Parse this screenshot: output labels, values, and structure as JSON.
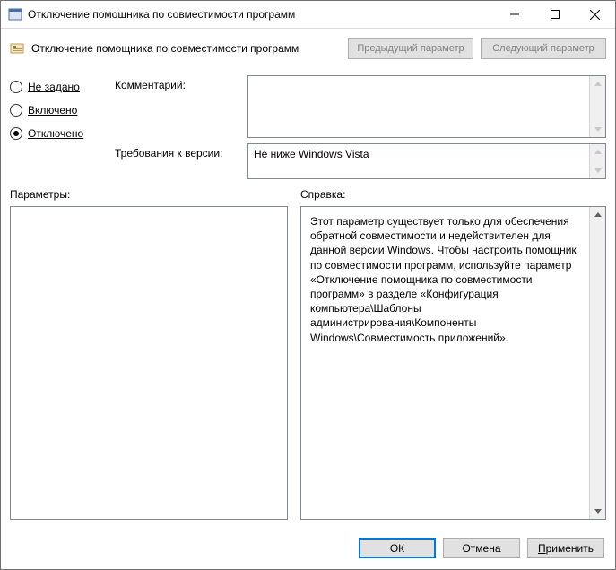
{
  "titlebar": {
    "title": "Отключение помощника по совместимости программ"
  },
  "toolbar": {
    "title": "Отключение помощника по совместимости программ",
    "prev_label": "Предыдущий параметр",
    "next_label": "Следующий параметр"
  },
  "radios": {
    "not_configured": "Не задано",
    "enabled": "Включено",
    "disabled": "Отключено"
  },
  "form": {
    "comment_label": "Комментарий:",
    "comment_value": "",
    "requirements_label": "Требования к версии:",
    "requirements_value": "Не ниже Windows Vista"
  },
  "lower": {
    "params_label": "Параметры:",
    "help_label": "Справка:",
    "help_text": "Этот параметр существует только для обеспечения обратной совместимости и недействителен для данной версии Windows. Чтобы настроить помощник по совместимости программ, используйте параметр «Отключение помощника по совместимости программ» в разделе «Конфигурация компьютера\\Шаблоны администрирования\\Компоненты Windows\\Совместимость приложений»."
  },
  "footer": {
    "ok": "ОК",
    "cancel": "Отмена",
    "apply_prefix": "П",
    "apply_rest": "рименить"
  }
}
